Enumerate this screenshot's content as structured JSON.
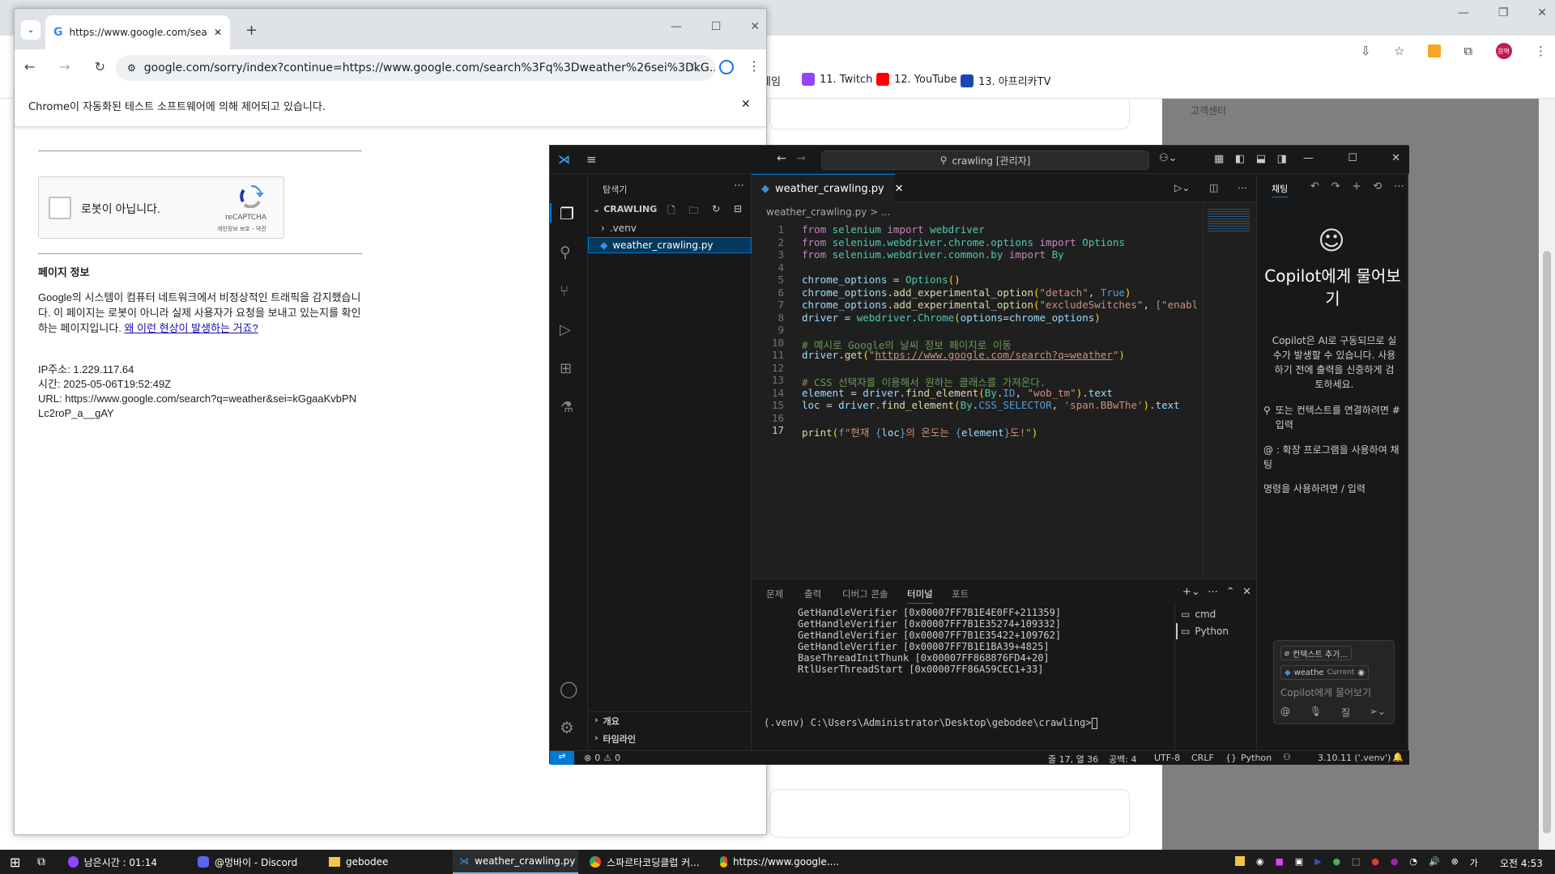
{
  "bg_browser": {
    "bookmarks": [
      "게임",
      "11. Twitch",
      "12. YouTube",
      "13. 아프리카TV"
    ],
    "right_label": "고객센터",
    "profile": "원혁"
  },
  "chrome": {
    "tab_title": "https://www.google.com/search",
    "url": "google.com/sorry/index?continue=https://www.google.com/search%3Fq%3Dweather%26sei%3DkG...",
    "infobar": "Chrome이 자동화된 테스트 소프트웨어에 의해 제어되고 있습니다.",
    "captcha_label": "로봇이 아닙니다.",
    "captcha_brand": "reCAPTCHA",
    "captcha_links": "개인정보 보호 - 약관",
    "info_heading": "페이지 정보",
    "info_text": "Google의 시스템이 컴퓨터 네트워크에서 비정상적인 트래픽을 감지했습니다. 이 페이지는 로봇이 아니라 실제 사용자가 요청을 보내고 있는지를 확인하는 페이지입니다.",
    "info_link": "왜 이런 현상이 발생하는 거죠?",
    "ip": "IP주소: 1.229.117.64",
    "time": "시간: 2025-05-06T19:52:49Z",
    "url_line": "URL: https://www.google.com/search?q=weather&sei=kGgaaKvbPNLc2roP_a__gAY"
  },
  "vscode": {
    "search": "crawling [관리자]",
    "explorer_title": "탐색기",
    "folder": "CRAWLING",
    "venv": ".venv",
    "file": "weather_crawling.py",
    "outline": "개요",
    "timeline": "타임라인",
    "tab": "weather_crawling.py",
    "breadcrumb": "weather_crawling.py > ...",
    "panel_tabs": [
      "문제",
      "출력",
      "디버그 콘솔",
      "터미널",
      "포트"
    ],
    "terminal": [
      "GetHandleVerifier [0x00007FF7B1E4E0FF+211359]",
      "GetHandleVerifier [0x00007FF7B1E35274+109332]",
      "GetHandleVerifier [0x00007FF7B1E35422+109762]",
      "GetHandleVerifier [0x00007FF7B1E1BA39+4825]",
      "BaseThreadInitThunk [0x00007FF868876FD4+20]",
      "RtlUserThreadStart [0x00007FF86A59CEC1+33]"
    ],
    "prompt": "(.venv) C:\\Users\\Administrator\\Desktop\\gebodee\\crawling>",
    "term_list": [
      "cmd",
      "Python"
    ],
    "chat_tab": "채팅",
    "chat_title": "Copilot에게 물어보기",
    "chat_desc": "Copilot은 AI로 구동되므로 실수가 발생할 수 있습니다. 사용하기 전에 출력을 신중하게 검토하세요.",
    "chat_hint1": "또는 컨텍스트를 연결하려면 # 입력",
    "chat_hint2": "@ : 확장 프로그램을 사용하여 채팅",
    "chat_hint3": "명령을 사용하려면 / 입력",
    "chat_ctx": "컨텍스트 추가...",
    "chat_file": "weathe",
    "chat_current": "Current",
    "chat_placeholder": "Copilot에게 물어보기",
    "chat_mode": "질",
    "status": {
      "errors": "0",
      "warnings": "0",
      "pos": "줄 17, 열 36",
      "spaces": "공백: 4",
      "enc": "UTF-8",
      "eol": "CRLF",
      "lang": "Python",
      "interp": "3.10.11 ('.venv')"
    }
  },
  "taskbar": {
    "items": [
      "남은시간 : 01:14",
      "@멍바이 - Discord",
      "gebodee",
      "weather_crawling.py ...",
      "스파르타코딩클럽 커...",
      "https://www.google...."
    ],
    "clock": "오전 4:53"
  }
}
